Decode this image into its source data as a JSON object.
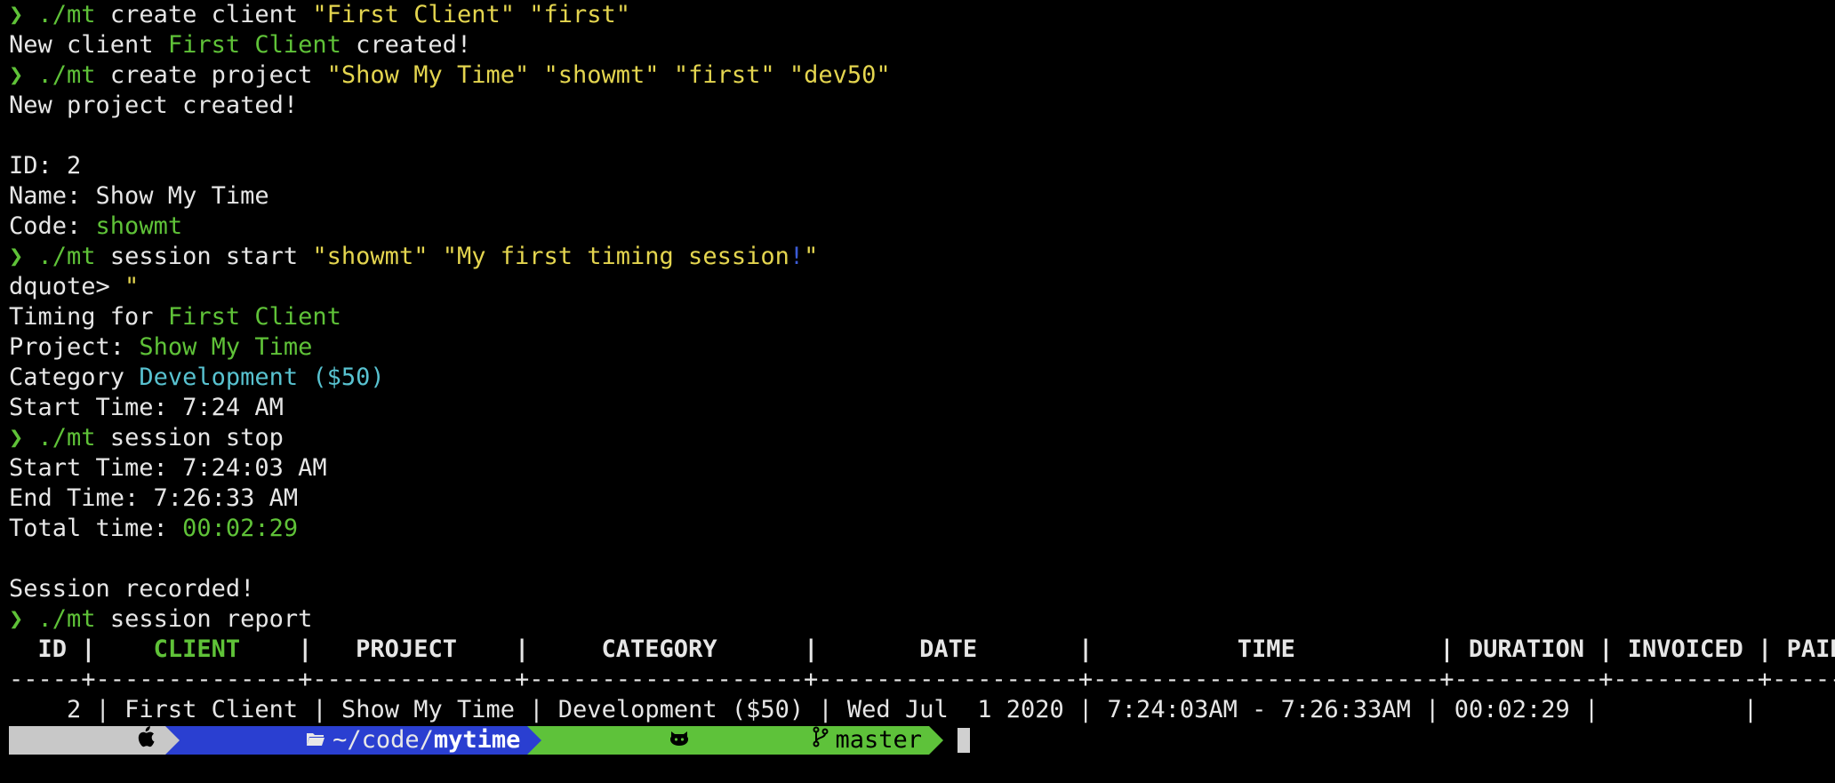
{
  "prompt_symbol": "❯",
  "lines": {
    "l1": {
      "cmd": "./mt",
      "args": " create client ",
      "s1": "\"First Client\"",
      "sp": " ",
      "s2": "\"first\""
    },
    "l2": {
      "a": "New client ",
      "b": "First Client",
      "c": " created!"
    },
    "l3": {
      "cmd": "./mt",
      "args": " create project ",
      "s1": "\"Show My Time\"",
      "s2": "\"showmt\"",
      "s3": "\"first\"",
      "s4": "\"dev50\""
    },
    "l4": "New project created!",
    "l5": "",
    "l6": "ID: 2",
    "l7": "Name: Show My Time",
    "l8": {
      "a": "Code: ",
      "b": "showmt"
    },
    "l9": {
      "cmd": "./mt",
      "args": " session start ",
      "s1": "\"showmt\"",
      "s2a": "\"My first timing session",
      "bang": "!",
      "s2b": "\""
    },
    "l10": {
      "a": "dquote> ",
      "b": "\""
    },
    "l11": {
      "a": "Timing for ",
      "b": "First Client"
    },
    "l12": {
      "a": "Project: ",
      "b": "Show My Time"
    },
    "l13": {
      "a": "Category ",
      "b": "Development ($50)"
    },
    "l14": "Start Time: 7:24 AM",
    "l15": {
      "cmd": "./mt",
      "args": " session stop"
    },
    "l16": "Start Time: 7:24:03 AM",
    "l17": "End Time: 7:26:33 AM",
    "l18": {
      "a": "Total time: ",
      "b": "00:02:29"
    },
    "l19": "",
    "l20": "Session recorded!",
    "l21": {
      "cmd": "./mt",
      "args": " session report"
    }
  },
  "table": {
    "headers": [
      "ID",
      "CLIENT",
      "PROJECT",
      "CATEGORY",
      "DATE",
      "TIME",
      "DURATION",
      "INVOICED",
      "PAID"
    ],
    "separator": "-----+--------------+--------------+-------------------+------------------+------------------------+----------+----------+-------",
    "row": {
      "id": "2",
      "client": "First Client",
      "project": "Show My Time",
      "category": "Development ($50)",
      "date": "Wed Jul  1 2020",
      "time": "7:24:03AM - 7:26:33AM",
      "duration": "00:02:29",
      "invoiced": "",
      "paid": ""
    }
  },
  "prompt_bar": {
    "apple_icon": "apple-icon",
    "folder_icon": "folder-icon",
    "dir_prefix": "~/code/",
    "dir_name": "mytime",
    "github_icon": "github-icon",
    "branch_icon": "git-branch-icon",
    "branch": "master"
  },
  "colors": {
    "background": "#000000",
    "foreground": "#e6e6e6",
    "green": "#5fc238",
    "yellow": "#e4d54f",
    "cyan": "#58c2d0",
    "dir_segment": "#2a3fd1",
    "git_segment": "#5ec23a",
    "apple_segment": "#c8c8c8"
  }
}
